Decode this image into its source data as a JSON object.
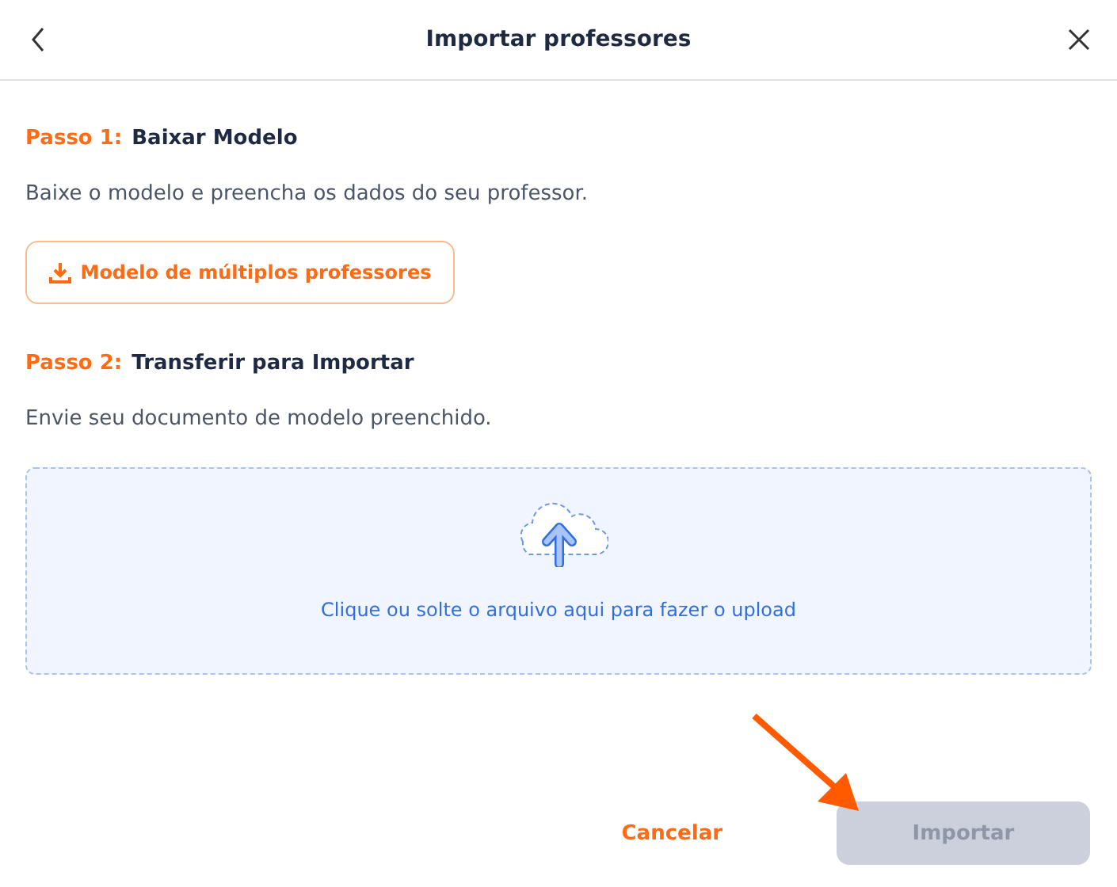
{
  "header": {
    "title": "Importar professores"
  },
  "steps": [
    {
      "label": "Passo 1:",
      "title": "Baixar Modelo",
      "description": "Baixe o modelo e preencha os dados do seu professor.",
      "kind": "download",
      "button": "Modelo de múltiplos professores"
    },
    {
      "label": "Passo 2:",
      "title": "Transferir para Importar",
      "description": "Envie seu documento de modelo preenchido.",
      "kind": "upload",
      "dropzone": "Clique ou solte o arquivo aqui para fazer o upload"
    }
  ],
  "footer": {
    "cancel": "Cancelar",
    "submit": {
      "label": "Importar",
      "disabled": true
    }
  }
}
